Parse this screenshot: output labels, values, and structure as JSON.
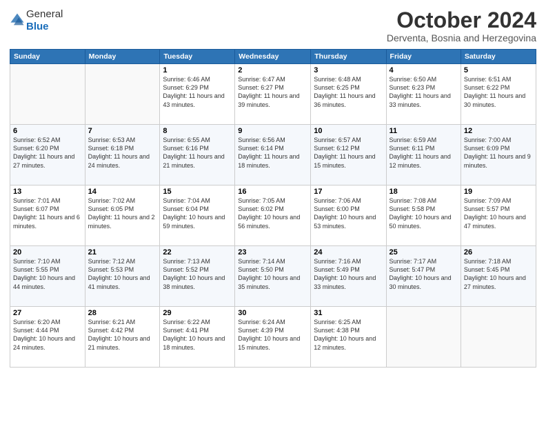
{
  "header": {
    "logo_general": "General",
    "logo_blue": "Blue",
    "month": "October 2024",
    "location": "Derventa, Bosnia and Herzegovina"
  },
  "weekdays": [
    "Sunday",
    "Monday",
    "Tuesday",
    "Wednesday",
    "Thursday",
    "Friday",
    "Saturday"
  ],
  "weeks": [
    [
      {
        "day": "",
        "info": ""
      },
      {
        "day": "",
        "info": ""
      },
      {
        "day": "1",
        "info": "Sunrise: 6:46 AM\nSunset: 6:29 PM\nDaylight: 11 hours and 43 minutes."
      },
      {
        "day": "2",
        "info": "Sunrise: 6:47 AM\nSunset: 6:27 PM\nDaylight: 11 hours and 39 minutes."
      },
      {
        "day": "3",
        "info": "Sunrise: 6:48 AM\nSunset: 6:25 PM\nDaylight: 11 hours and 36 minutes."
      },
      {
        "day": "4",
        "info": "Sunrise: 6:50 AM\nSunset: 6:23 PM\nDaylight: 11 hours and 33 minutes."
      },
      {
        "day": "5",
        "info": "Sunrise: 6:51 AM\nSunset: 6:22 PM\nDaylight: 11 hours and 30 minutes."
      }
    ],
    [
      {
        "day": "6",
        "info": "Sunrise: 6:52 AM\nSunset: 6:20 PM\nDaylight: 11 hours and 27 minutes."
      },
      {
        "day": "7",
        "info": "Sunrise: 6:53 AM\nSunset: 6:18 PM\nDaylight: 11 hours and 24 minutes."
      },
      {
        "day": "8",
        "info": "Sunrise: 6:55 AM\nSunset: 6:16 PM\nDaylight: 11 hours and 21 minutes."
      },
      {
        "day": "9",
        "info": "Sunrise: 6:56 AM\nSunset: 6:14 PM\nDaylight: 11 hours and 18 minutes."
      },
      {
        "day": "10",
        "info": "Sunrise: 6:57 AM\nSunset: 6:12 PM\nDaylight: 11 hours and 15 minutes."
      },
      {
        "day": "11",
        "info": "Sunrise: 6:59 AM\nSunset: 6:11 PM\nDaylight: 11 hours and 12 minutes."
      },
      {
        "day": "12",
        "info": "Sunrise: 7:00 AM\nSunset: 6:09 PM\nDaylight: 11 hours and 9 minutes."
      }
    ],
    [
      {
        "day": "13",
        "info": "Sunrise: 7:01 AM\nSunset: 6:07 PM\nDaylight: 11 hours and 6 minutes."
      },
      {
        "day": "14",
        "info": "Sunrise: 7:02 AM\nSunset: 6:05 PM\nDaylight: 11 hours and 2 minutes."
      },
      {
        "day": "15",
        "info": "Sunrise: 7:04 AM\nSunset: 6:04 PM\nDaylight: 10 hours and 59 minutes."
      },
      {
        "day": "16",
        "info": "Sunrise: 7:05 AM\nSunset: 6:02 PM\nDaylight: 10 hours and 56 minutes."
      },
      {
        "day": "17",
        "info": "Sunrise: 7:06 AM\nSunset: 6:00 PM\nDaylight: 10 hours and 53 minutes."
      },
      {
        "day": "18",
        "info": "Sunrise: 7:08 AM\nSunset: 5:58 PM\nDaylight: 10 hours and 50 minutes."
      },
      {
        "day": "19",
        "info": "Sunrise: 7:09 AM\nSunset: 5:57 PM\nDaylight: 10 hours and 47 minutes."
      }
    ],
    [
      {
        "day": "20",
        "info": "Sunrise: 7:10 AM\nSunset: 5:55 PM\nDaylight: 10 hours and 44 minutes."
      },
      {
        "day": "21",
        "info": "Sunrise: 7:12 AM\nSunset: 5:53 PM\nDaylight: 10 hours and 41 minutes."
      },
      {
        "day": "22",
        "info": "Sunrise: 7:13 AM\nSunset: 5:52 PM\nDaylight: 10 hours and 38 minutes."
      },
      {
        "day": "23",
        "info": "Sunrise: 7:14 AM\nSunset: 5:50 PM\nDaylight: 10 hours and 35 minutes."
      },
      {
        "day": "24",
        "info": "Sunrise: 7:16 AM\nSunset: 5:49 PM\nDaylight: 10 hours and 33 minutes."
      },
      {
        "day": "25",
        "info": "Sunrise: 7:17 AM\nSunset: 5:47 PM\nDaylight: 10 hours and 30 minutes."
      },
      {
        "day": "26",
        "info": "Sunrise: 7:18 AM\nSunset: 5:45 PM\nDaylight: 10 hours and 27 minutes."
      }
    ],
    [
      {
        "day": "27",
        "info": "Sunrise: 6:20 AM\nSunset: 4:44 PM\nDaylight: 10 hours and 24 minutes."
      },
      {
        "day": "28",
        "info": "Sunrise: 6:21 AM\nSunset: 4:42 PM\nDaylight: 10 hours and 21 minutes."
      },
      {
        "day": "29",
        "info": "Sunrise: 6:22 AM\nSunset: 4:41 PM\nDaylight: 10 hours and 18 minutes."
      },
      {
        "day": "30",
        "info": "Sunrise: 6:24 AM\nSunset: 4:39 PM\nDaylight: 10 hours and 15 minutes."
      },
      {
        "day": "31",
        "info": "Sunrise: 6:25 AM\nSunset: 4:38 PM\nDaylight: 10 hours and 12 minutes."
      },
      {
        "day": "",
        "info": ""
      },
      {
        "day": "",
        "info": ""
      }
    ]
  ]
}
